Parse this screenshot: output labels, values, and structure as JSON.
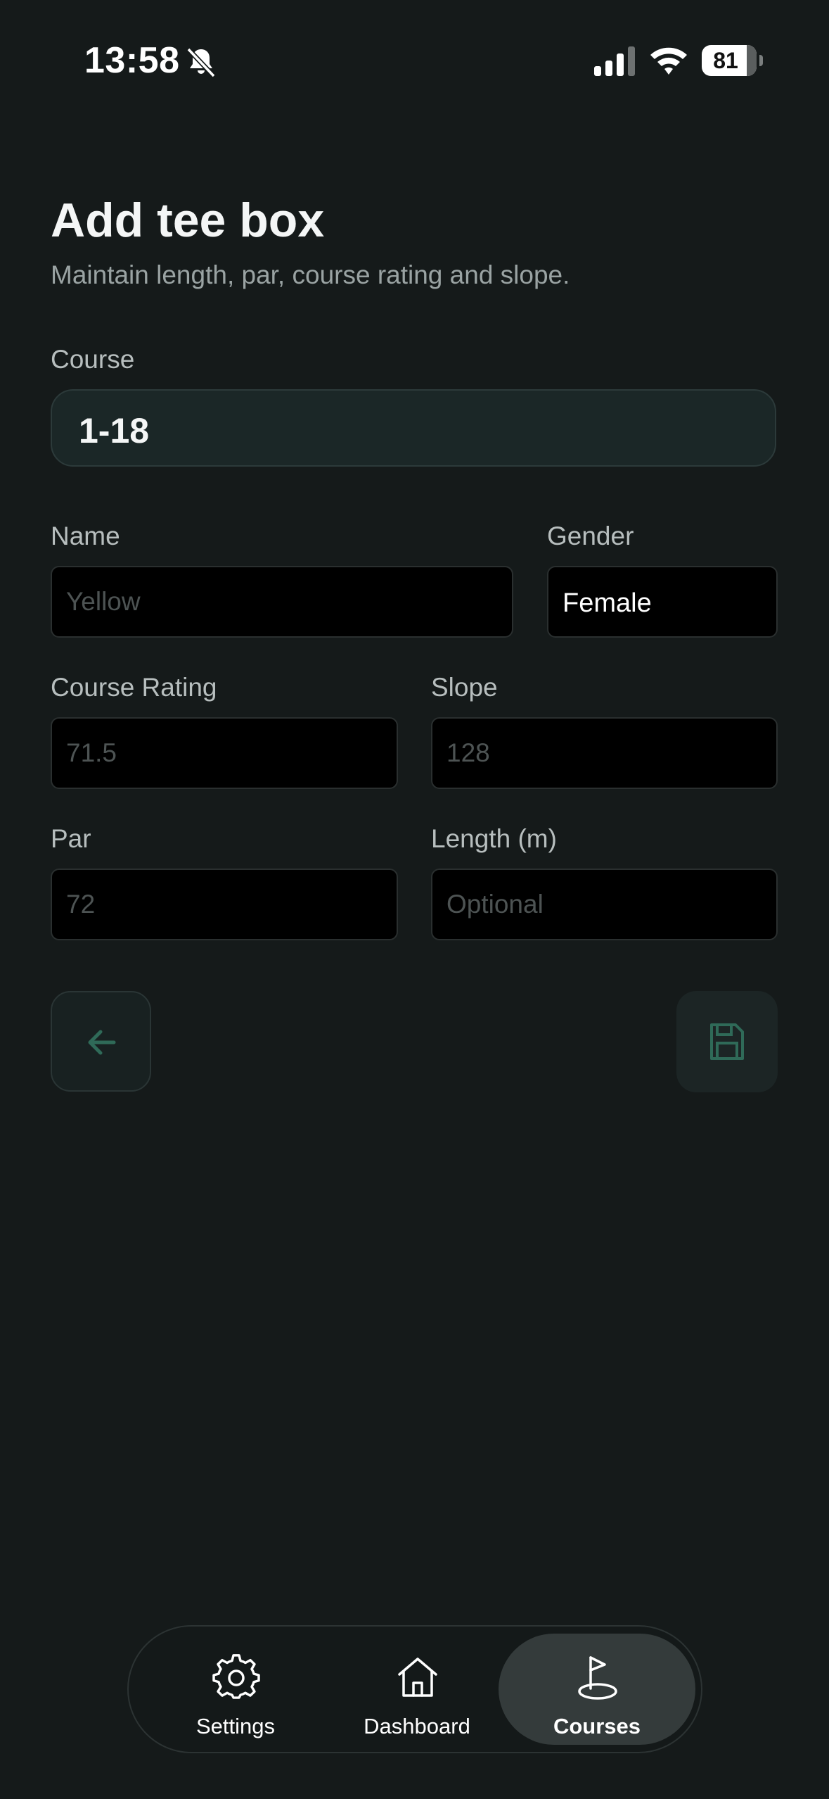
{
  "status_bar": {
    "time": "13:58",
    "battery": "81"
  },
  "header": {
    "title": "Add tee box",
    "subtitle": "Maintain length, par, course rating and slope."
  },
  "form": {
    "course_label": "Course",
    "course_value": "1-18",
    "name_label": "Name",
    "name_placeholder": "Yellow",
    "gender_label": "Gender",
    "gender_value": "Female",
    "rating_label": "Course Rating",
    "rating_placeholder": "71.5",
    "slope_label": "Slope",
    "slope_placeholder": "128",
    "par_label": "Par",
    "par_placeholder": "72",
    "length_label": "Length (m)",
    "length_placeholder": "Optional"
  },
  "actions": {
    "back_icon": "arrow-left-icon",
    "save_icon": "floppy-disk-icon",
    "accent_color": "#2f6a58"
  },
  "tab_bar": {
    "items": [
      {
        "label": "Settings",
        "icon": "gear-icon",
        "active": false
      },
      {
        "label": "Dashboard",
        "icon": "house-icon",
        "active": false
      },
      {
        "label": "Courses",
        "icon": "golf-flag-icon",
        "active": true
      }
    ]
  }
}
